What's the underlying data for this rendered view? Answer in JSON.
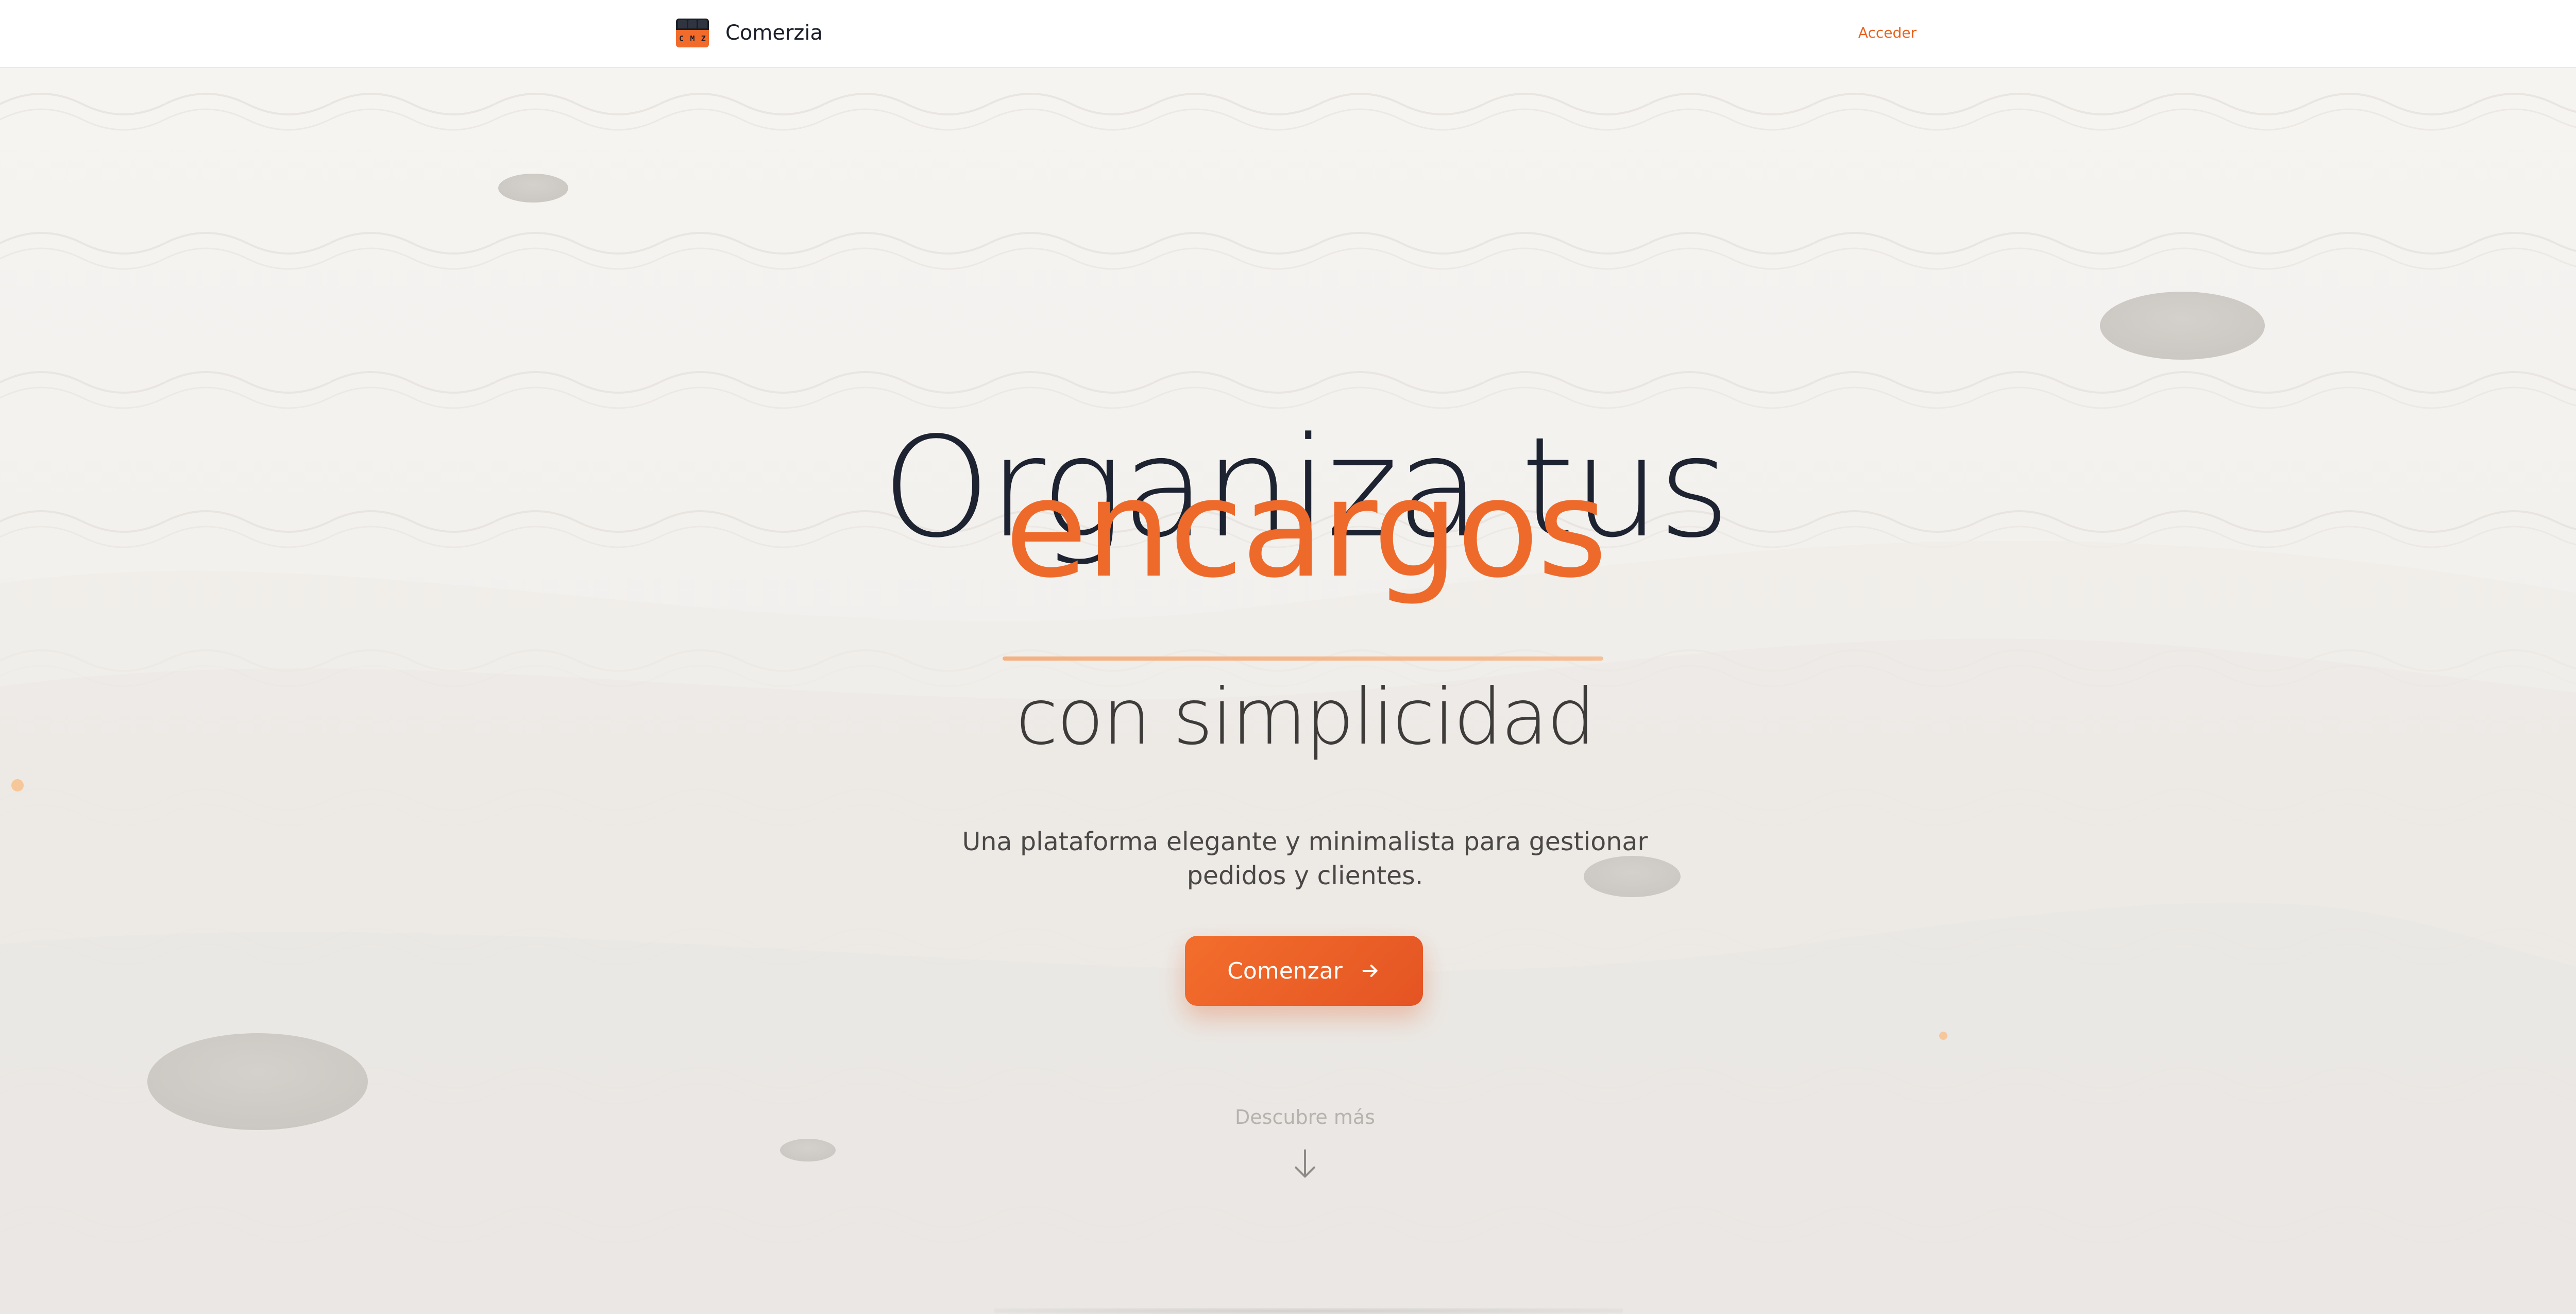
{
  "navbar": {
    "logo_letters": [
      "C",
      "M",
      "Z"
    ],
    "brand": "Comerzia",
    "login_label": "Acceder"
  },
  "hero": {
    "title_line1": "Organiza tus",
    "title_highlight": "encargos",
    "title_line3": "con simplicidad",
    "subtitle": "Una plataforma elegante y minimalista para gestionar pedidos y clientes.",
    "cta_label": "Comenzar",
    "discover_label": "Descubre más"
  },
  "colors": {
    "accent": "#ee6a2b",
    "accent_dark": "#e45423",
    "heading": "#1d2331",
    "background": "#f3f1ee"
  },
  "icons": {
    "cta": "arrow-right-icon",
    "discover": "arrow-down-icon",
    "logo": "cmz-logo-icon"
  }
}
